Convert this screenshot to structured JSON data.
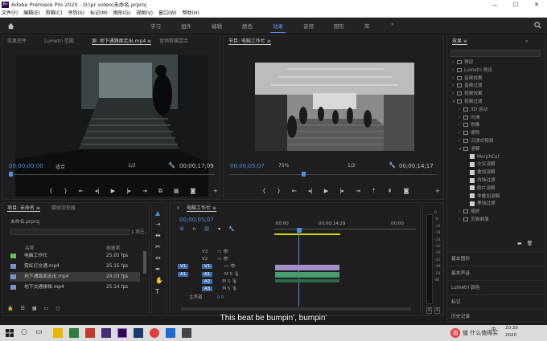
{
  "window": {
    "title": "Adobe Premiere Pro 2020 - D:\\pr video\\未命名.prproj",
    "app_icon": "Pr",
    "controls": [
      "—",
      "☐",
      "✕"
    ]
  },
  "menu": [
    "文件(F)",
    "编辑(E)",
    "剪辑(C)",
    "序列(S)",
    "标记(M)",
    "图形(G)",
    "视图(V)",
    "窗口(W)",
    "帮助(H)"
  ],
  "workspaces": [
    "学习",
    "组件",
    "编辑",
    "颜色",
    "效果",
    "音频",
    "图形",
    "库"
  ],
  "workspace_active": "效果",
  "workspace_more": "»",
  "source": {
    "tabs": [
      "效果控件",
      "Lumetri 范围",
      "源: 地下通路面走出.mp4 ≡",
      "音频剪辑混合"
    ],
    "timecode_left": "00;00;00;00",
    "fit": "适合",
    "fraction": "1/2",
    "timecode_right": "00;00;17;09"
  },
  "program": {
    "tab": "节目: 电脑工作忙 ≡",
    "timecode_left": "00;00;05;07",
    "zoom": "75%",
    "fraction": "1/2",
    "timecode_right": "00;00;14;17"
  },
  "project": {
    "tabs": [
      "项目: 未命名 ≡",
      "媒体浏览器"
    ],
    "file": "未命名.prproj",
    "count": "1 项已...",
    "col_name": "名称",
    "col_fps": "帧速率",
    "items": [
      {
        "name": "电脑工作忙",
        "fps": "25.05 fps",
        "color": "#5ec25e"
      },
      {
        "name": "霓虹灯交通.mp4",
        "fps": "25.15 fps",
        "color": "#7b8fd6"
      },
      {
        "name": "地下通路面走出.mp4",
        "fps": "24.03 fps",
        "color": "#7b8fd6"
      },
      {
        "name": "地下交通楼梯.mp4",
        "fps": "25.14 fps",
        "color": "#7b8fd6"
      }
    ]
  },
  "timeline": {
    "tab": "电脑工作忙 ≡",
    "timecode": "00;00;05;07",
    "ruler": [
      ":00;00",
      "00;00;14;29",
      "00;00"
    ],
    "tracks": [
      "V3",
      "V2",
      "V1",
      "A1",
      "A2",
      "A3"
    ],
    "master_label": "主声道",
    "master_value": "0.0"
  },
  "effects": {
    "title": "效果 ≡",
    "tree": [
      {
        "label": "预设",
        "lvl": 0,
        "type": "folder"
      },
      {
        "label": "Lumetri 预设",
        "lvl": 0,
        "type": "folder"
      },
      {
        "label": "音频效果",
        "lvl": 0,
        "type": "folder"
      },
      {
        "label": "音频过渡",
        "lvl": 0,
        "type": "folder"
      },
      {
        "label": "视频效果",
        "lvl": 0,
        "type": "folder"
      },
      {
        "label": "视频过渡",
        "lvl": 0,
        "type": "folder",
        "open": true
      },
      {
        "label": "3D 运动",
        "lvl": 1,
        "type": "folder"
      },
      {
        "label": "内滑",
        "lvl": 1,
        "type": "folder"
      },
      {
        "label": "划像",
        "lvl": 1,
        "type": "folder"
      },
      {
        "label": "擦除",
        "lvl": 1,
        "type": "folder"
      },
      {
        "label": "沉浸式视频",
        "lvl": 1,
        "type": "folder"
      },
      {
        "label": "溶解",
        "lvl": 1,
        "type": "folder",
        "open": true
      },
      {
        "label": "MorphCut",
        "lvl": 2,
        "type": "fx"
      },
      {
        "label": "交叉溶解",
        "lvl": 2,
        "type": "fx"
      },
      {
        "label": "叠加溶解",
        "lvl": 2,
        "type": "fx"
      },
      {
        "label": "白场过渡",
        "lvl": 2,
        "type": "fx"
      },
      {
        "label": "胶片溶解",
        "lvl": 2,
        "type": "fx"
      },
      {
        "label": "非叠加溶解",
        "lvl": 2,
        "type": "fx"
      },
      {
        "label": "黑场过渡",
        "lvl": 2,
        "type": "fx"
      },
      {
        "label": "缩放",
        "lvl": 1,
        "type": "folder"
      },
      {
        "label": "页面剥落",
        "lvl": 1,
        "type": "folder"
      }
    ],
    "sections": [
      "基本图形",
      "基本声音",
      "Lumetri 颜色",
      "标记",
      "历史记录"
    ]
  },
  "meter_labels": [
    "0",
    "-6",
    "-12",
    "-18",
    "-24",
    "-30",
    "-36",
    "-42",
    "-48",
    "-54",
    "dB"
  ],
  "meter_buttons": [
    "S",
    "S"
  ],
  "subtitle": "This beat be bumpin', bumpin'",
  "taskbar": {
    "lang": "中",
    "time": "20:20",
    "date": "2020",
    "watermark": "值 什么值得买"
  }
}
